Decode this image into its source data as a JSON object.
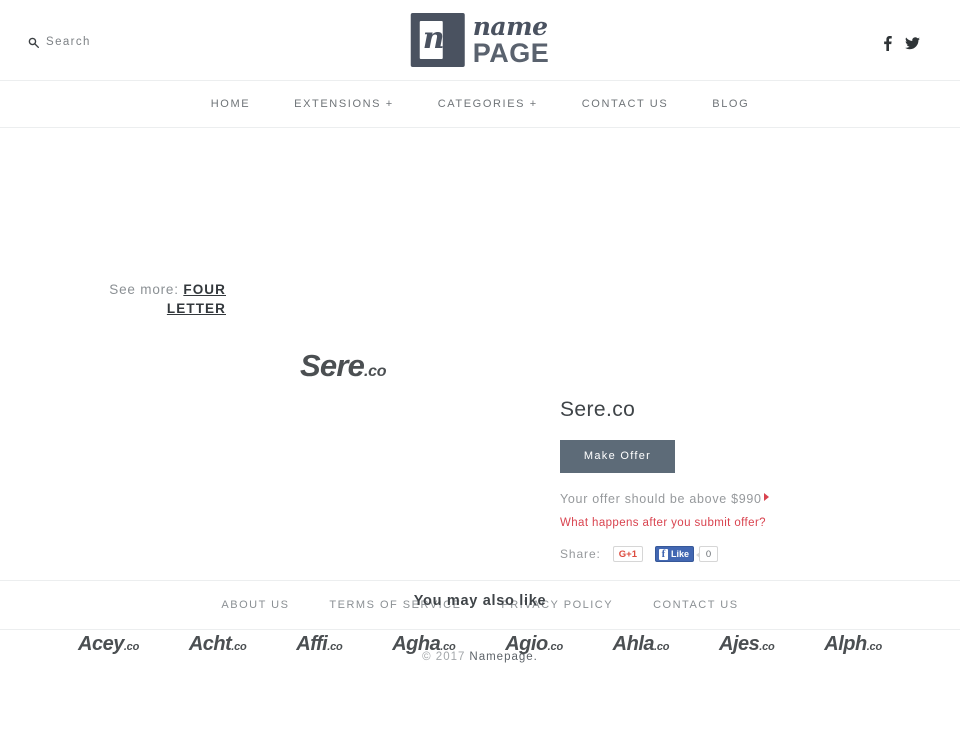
{
  "header": {
    "search": {
      "label": "Search",
      "icon": "search-icon"
    },
    "logo": {
      "mark_glyph": "n",
      "name": "name",
      "page": "PAGE"
    },
    "social": [
      {
        "name": "facebook-icon",
        "label": "f"
      },
      {
        "name": "twitter-icon",
        "label": "t"
      }
    ]
  },
  "nav": {
    "items": [
      {
        "label": "HOME"
      },
      {
        "label": "EXTENSIONS +"
      },
      {
        "label": "CATEGORIES +"
      },
      {
        "label": "CONTACT US"
      },
      {
        "label": "BLOG"
      }
    ]
  },
  "breadcrumb": {
    "prefix": "See more:",
    "category": "FOUR LETTER"
  },
  "listing": {
    "art_name": "Sere",
    "art_tld": ".co",
    "title": "Sere.co",
    "make_offer_label": "Make Offer",
    "offer_note": "Your offer should be above $990",
    "offer_minimum": "$990",
    "after_submit_link": "What happens after you submit offer?",
    "share_label": "Share:",
    "gplus_label": "G+1",
    "fb_like_label": "Like",
    "fb_like_count": "0",
    "accent_color": "#d9434f",
    "button_color": "#5d6b78"
  },
  "also_like": {
    "title": "You may also like",
    "items": [
      {
        "name": "Acey",
        "tld": ".co"
      },
      {
        "name": "Acht",
        "tld": ".co"
      },
      {
        "name": "Affi",
        "tld": ".co"
      },
      {
        "name": "Agha",
        "tld": ".co"
      },
      {
        "name": "Agio",
        "tld": ".co"
      },
      {
        "name": "Ahla",
        "tld": ".co"
      },
      {
        "name": "Ajes",
        "tld": ".co"
      },
      {
        "name": "Alph",
        "tld": ".co"
      }
    ]
  },
  "footer": {
    "links": [
      {
        "label": "ABOUT US"
      },
      {
        "label": "TERMS OF SERVICE"
      },
      {
        "label": "PRIVACY POLICY"
      },
      {
        "label": "CONTACT US"
      }
    ],
    "copyright": "© 2017",
    "brand": "Namepage."
  }
}
